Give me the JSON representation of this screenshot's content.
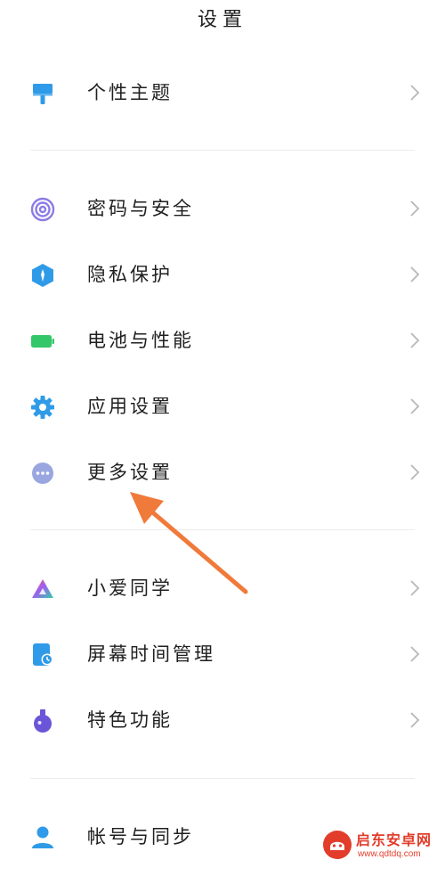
{
  "header": {
    "title": "设置"
  },
  "sections": [
    {
      "items": [
        {
          "label": "个性主题",
          "icon": "paint-roller-icon"
        }
      ]
    },
    {
      "items": [
        {
          "label": "密码与安全",
          "icon": "fingerprint-icon"
        },
        {
          "label": "隐私保护",
          "icon": "privacy-shield-icon"
        },
        {
          "label": "电池与性能",
          "icon": "battery-icon"
        },
        {
          "label": "应用设置",
          "icon": "gear-icon"
        },
        {
          "label": "更多设置",
          "icon": "more-dots-icon"
        }
      ]
    },
    {
      "items": [
        {
          "label": "小爱同学",
          "icon": "xiaoai-icon"
        },
        {
          "label": "屏幕时间管理",
          "icon": "screen-time-icon"
        },
        {
          "label": "特色功能",
          "icon": "flask-icon"
        }
      ]
    },
    {
      "items": [
        {
          "label": "帐号与同步",
          "icon": "account-icon"
        }
      ]
    }
  ],
  "watermark": {
    "name": "启东安卓网",
    "url": "www.qdtdq.com"
  },
  "colors": {
    "accent_blue": "#2f9be8",
    "battery_green": "#34c76a",
    "more_gray": "#9aa6e0",
    "flask_purple": "#6a55d8",
    "annotation_arrow": "#f07a3a",
    "watermark_red": "#e23d2b"
  }
}
